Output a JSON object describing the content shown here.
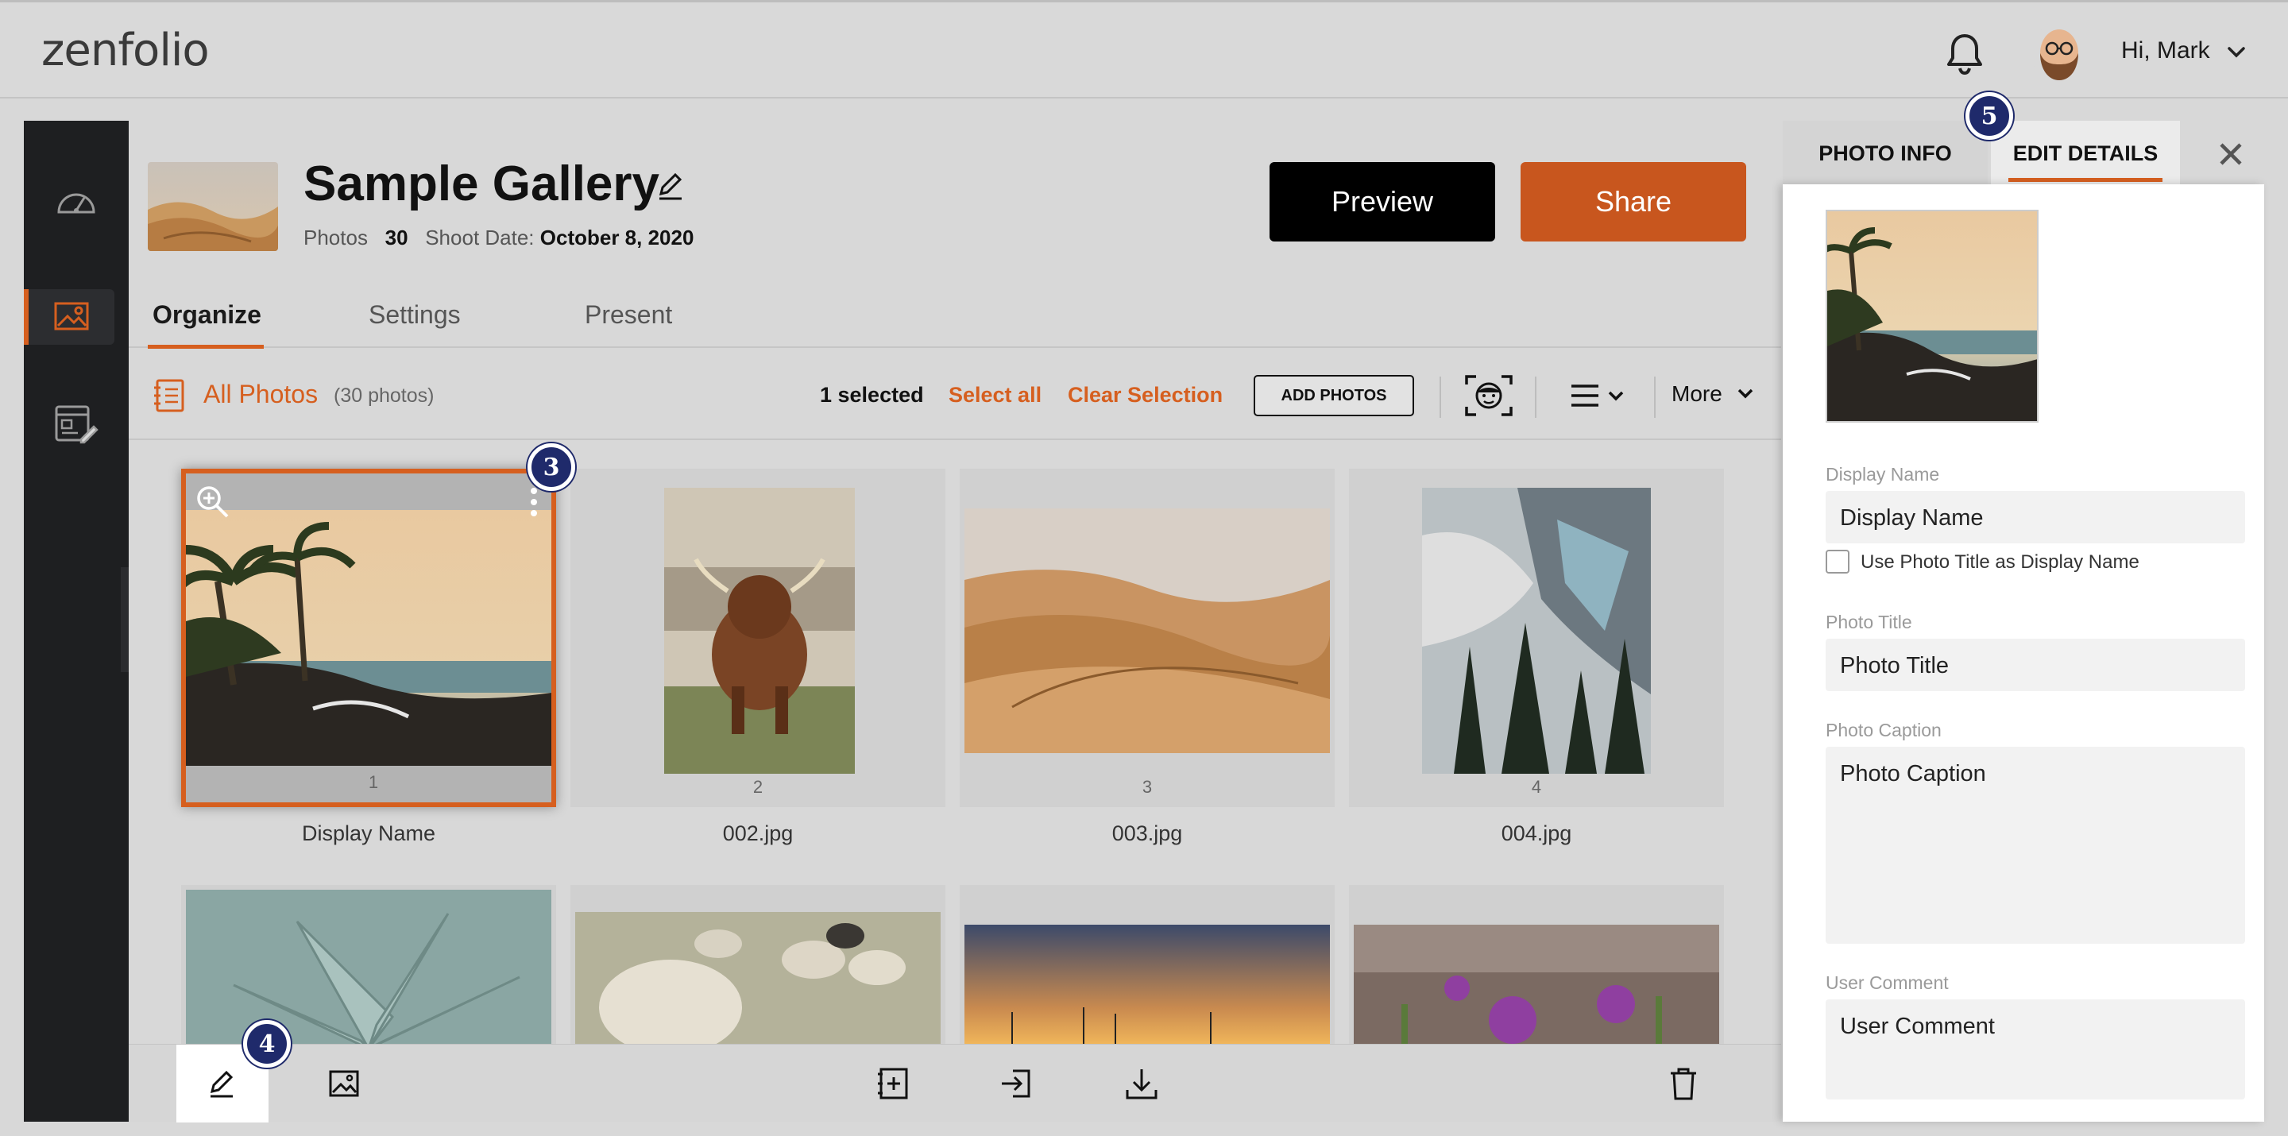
{
  "app": {
    "logo": "zenfolio"
  },
  "header": {
    "greeting": "Hi, Mark"
  },
  "sidebar": {
    "items": [
      {
        "name": "dashboard",
        "icon": "gauge-icon"
      },
      {
        "name": "galleries",
        "icon": "image-icon",
        "active": true
      },
      {
        "name": "website",
        "icon": "web-edit-icon"
      }
    ]
  },
  "gallery": {
    "title": "Sample Gallery",
    "photos_label": "Photos",
    "photos_count": "30",
    "shoot_date_label": "Shoot Date:",
    "shoot_date": "October 8, 2020",
    "preview_label": "Preview",
    "share_label": "Share"
  },
  "tabs": [
    {
      "label": "Organize",
      "active": true
    },
    {
      "label": "Settings"
    },
    {
      "label": "Present"
    }
  ],
  "toolbar": {
    "all_photos": "All Photos",
    "count": "(30 photos)",
    "selected": "1 selected",
    "select_all": "Select all",
    "clear_selection": "Clear Selection",
    "add_photos": "ADD PHOTOS",
    "more": "More"
  },
  "photos": [
    {
      "num": "1",
      "name": "Display Name",
      "selected": true,
      "subject": "tropical coast"
    },
    {
      "num": "2",
      "name": "002.jpg",
      "subject": "highland cow"
    },
    {
      "num": "3",
      "name": "003.jpg",
      "subject": "desert dunes"
    },
    {
      "num": "4",
      "name": "004.jpg",
      "subject": "glacier forest"
    },
    {
      "subject": "succulent"
    },
    {
      "subject": "sheep"
    },
    {
      "subject": "wind farm sunset"
    },
    {
      "subject": "purple flowers"
    }
  ],
  "details_panel": {
    "tab_info": "PHOTO INFO",
    "tab_edit": "EDIT DETAILS",
    "display_name_label": "Display Name",
    "display_name_value": "Display Name",
    "use_title_label": "Use Photo Title as Display Name",
    "photo_title_label": "Photo Title",
    "photo_title_value": "Photo Title",
    "photo_caption_label": "Photo Caption",
    "photo_caption_value": "Photo Caption",
    "user_comment_label": "User Comment",
    "user_comment_value": "User Comment"
  },
  "badges": {
    "b3": "3",
    "b4": "4",
    "b5": "5"
  },
  "colors": {
    "accent": "#d65f1f",
    "sidebar": "#1e1f21",
    "badge": "#1f2a6b"
  }
}
